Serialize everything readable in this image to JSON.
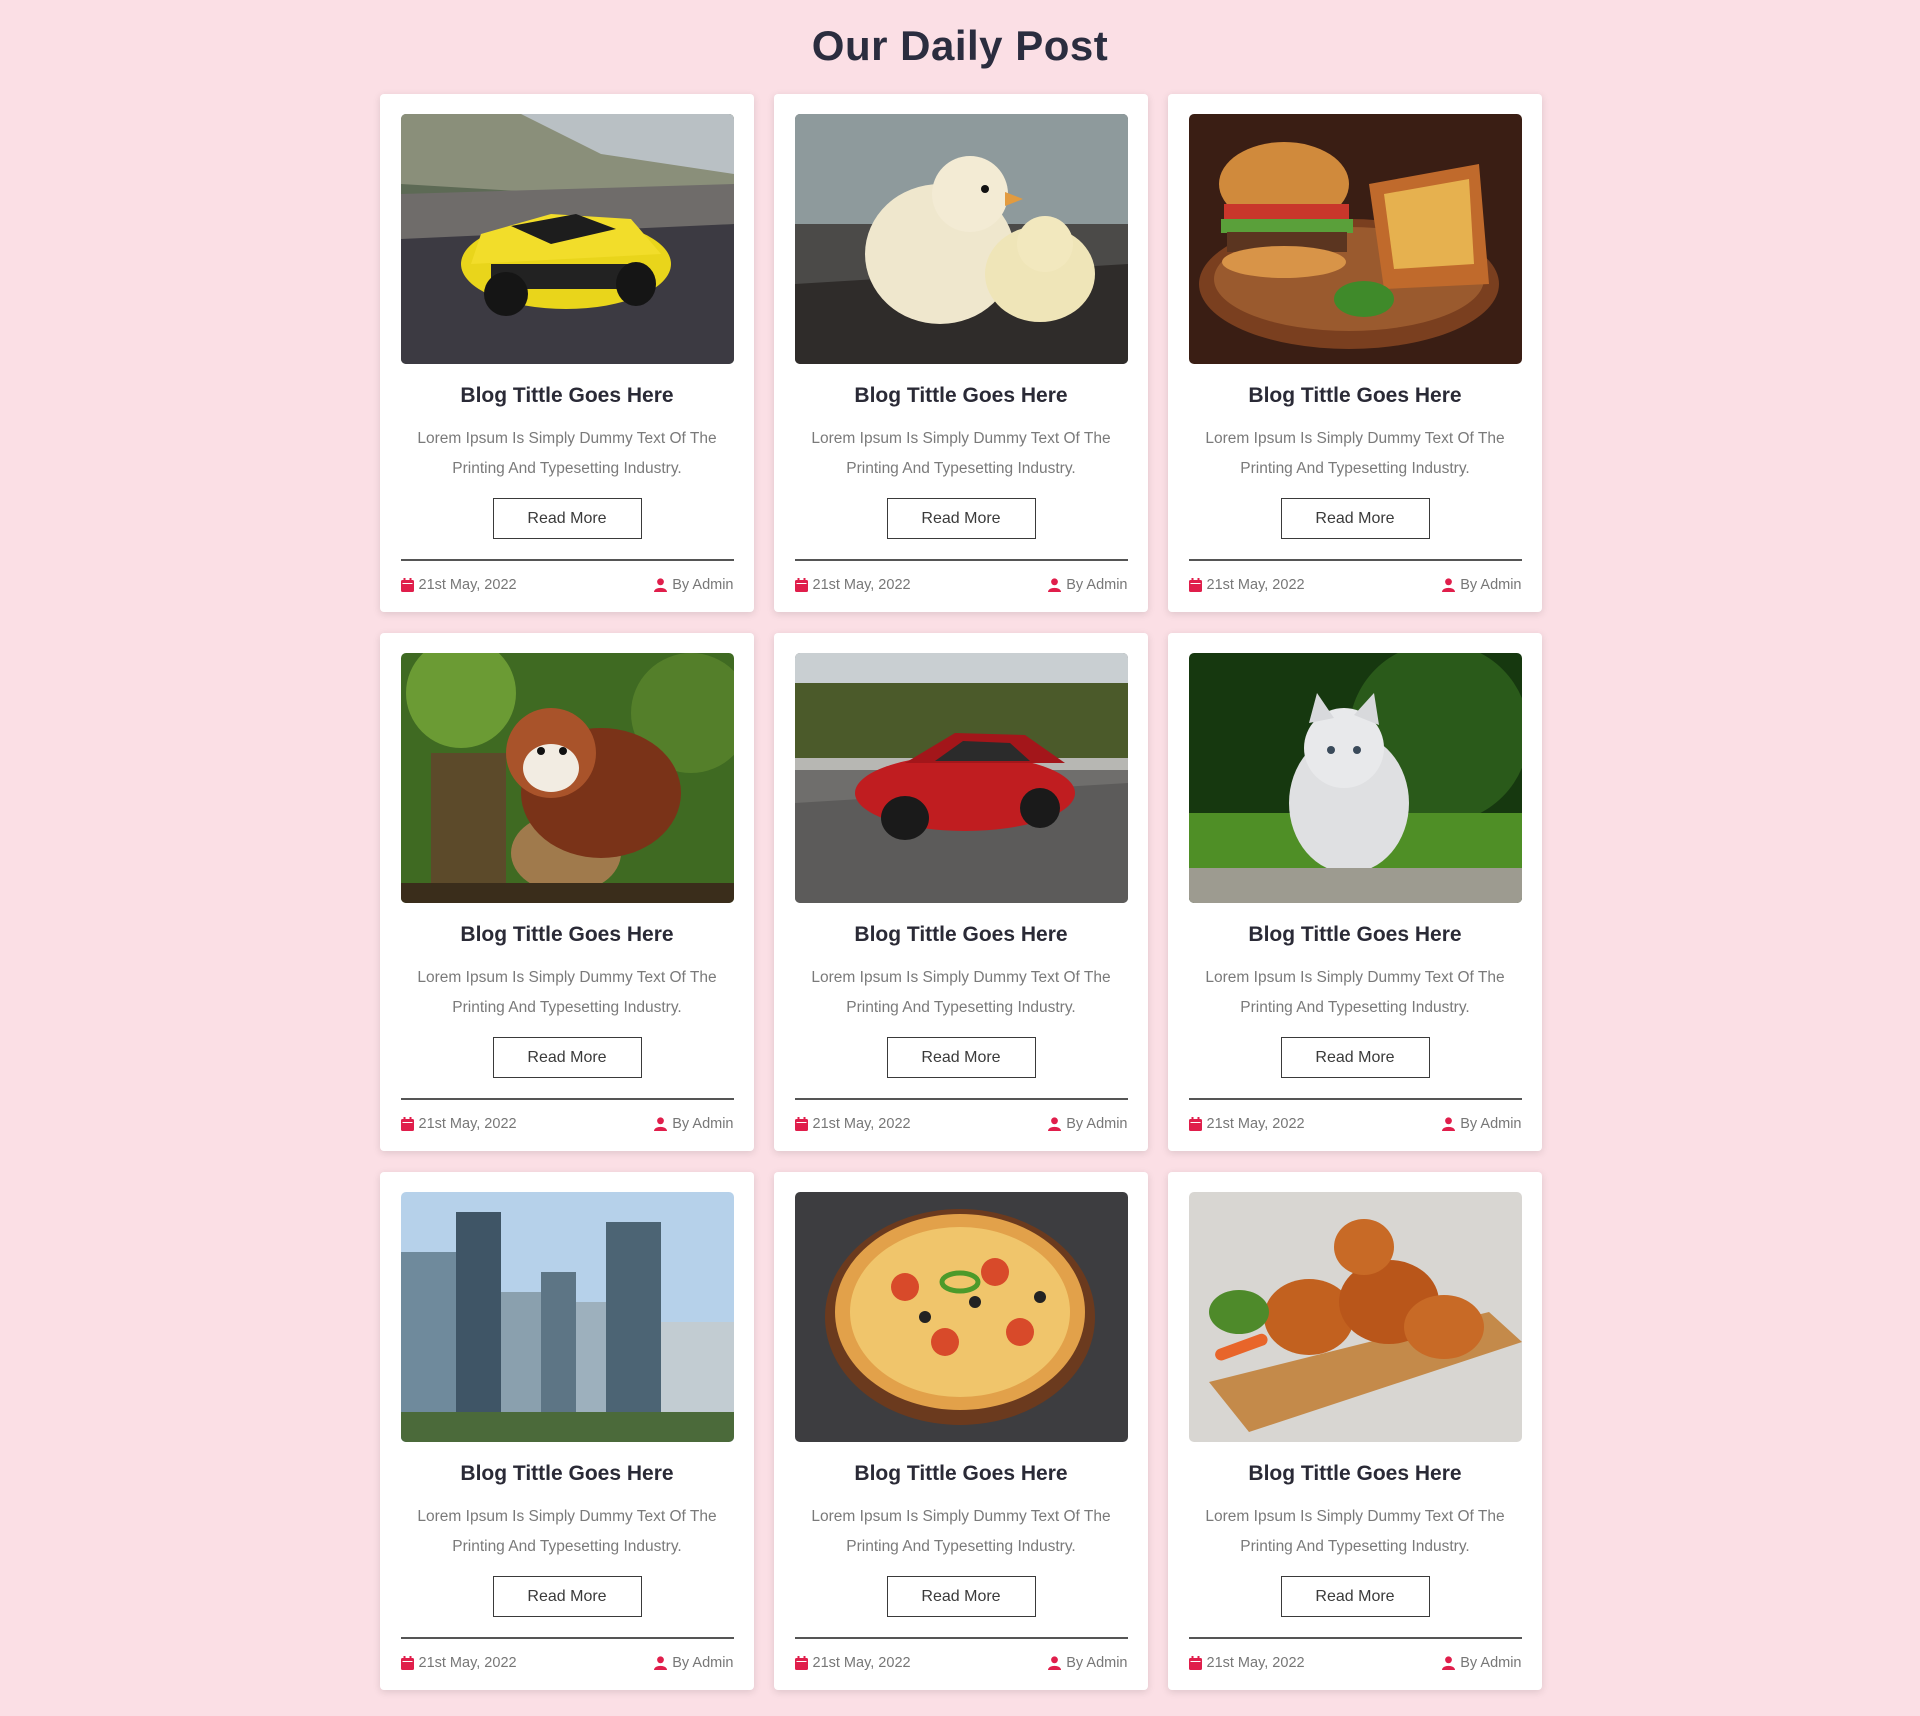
{
  "page": {
    "title": "Our Daily Post"
  },
  "icons": {
    "date": "calendar-icon",
    "author": "user-icon",
    "accent": "#e01e4b"
  },
  "posts": [
    {
      "image": "yellow-sports-car",
      "title": "Blog Tittle Goes Here",
      "desc": "Lorem Ipsum Is Simply Dummy Text Of The Printing And Typesetting Industry.",
      "button": "Read More",
      "date": "21st May, 2022",
      "author": "By Admin"
    },
    {
      "image": "baby-chicks",
      "title": "Blog Tittle Goes Here",
      "desc": "Lorem Ipsum Is Simply Dummy Text Of The Printing And Typesetting Industry.",
      "button": "Read More",
      "date": "21st May, 2022",
      "author": "By Admin"
    },
    {
      "image": "burger-and-fries",
      "title": "Blog Tittle Goes Here",
      "desc": "Lorem Ipsum Is Simply Dummy Text Of The Printing And Typesetting Industry.",
      "button": "Read More",
      "date": "21st May, 2022",
      "author": "By Admin"
    },
    {
      "image": "red-panda",
      "title": "Blog Tittle Goes Here",
      "desc": "Lorem Ipsum Is Simply Dummy Text Of The Printing And Typesetting Industry.",
      "button": "Read More",
      "date": "21st May, 2022",
      "author": "By Admin"
    },
    {
      "image": "red-sports-car",
      "title": "Blog Tittle Goes Here",
      "desc": "Lorem Ipsum Is Simply Dummy Text Of The Printing And Typesetting Industry.",
      "button": "Read More",
      "date": "21st May, 2022",
      "author": "By Admin"
    },
    {
      "image": "white-kitten",
      "title": "Blog Tittle Goes Here",
      "desc": "Lorem Ipsum Is Simply Dummy Text Of The Printing And Typesetting Industry.",
      "button": "Read More",
      "date": "21st May, 2022",
      "author": "By Admin"
    },
    {
      "image": "city-skyline",
      "title": "Blog Tittle Goes Here",
      "desc": "Lorem Ipsum Is Simply Dummy Text Of The Printing And Typesetting Industry.",
      "button": "Read More",
      "date": "21st May, 2022",
      "author": "By Admin"
    },
    {
      "image": "pizza",
      "title": "Blog Tittle Goes Here",
      "desc": "Lorem Ipsum Is Simply Dummy Text Of The Printing And Typesetting Industry.",
      "button": "Read More",
      "date": "21st May, 2022",
      "author": "By Admin"
    },
    {
      "image": "fried-chicken",
      "title": "Blog Tittle Goes Here",
      "desc": "Lorem Ipsum Is Simply Dummy Text Of The Printing And Typesetting Industry.",
      "button": "Read More",
      "date": "21st May, 2022",
      "author": "By Admin"
    }
  ]
}
